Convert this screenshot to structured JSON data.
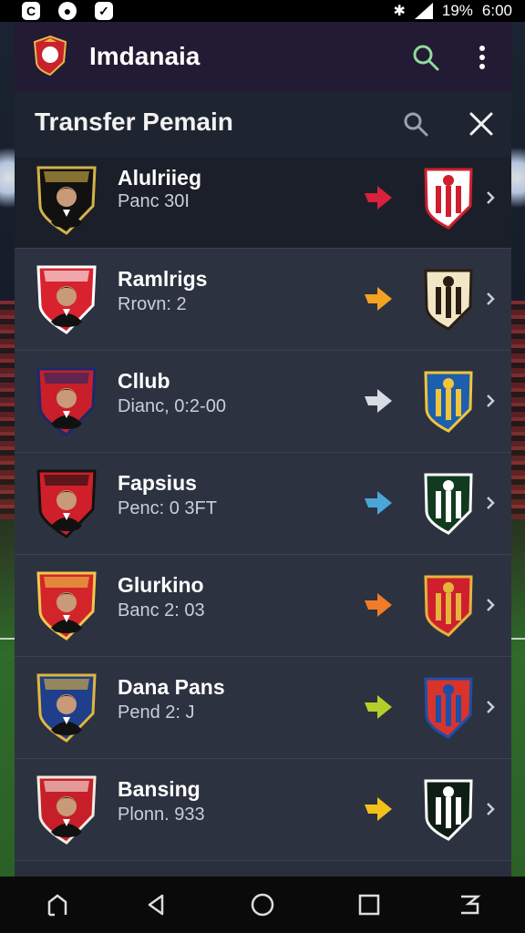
{
  "status_bar": {
    "left_icons": [
      "c-app-icon",
      "circle-app-icon",
      "check-app-icon"
    ],
    "battery": "19%",
    "time": "6:00"
  },
  "app": {
    "title": "Imdanaia",
    "icons": [
      "search-icon",
      "more-vert-icon"
    ]
  },
  "screen": {
    "title": "Transfer Pemain",
    "icons": [
      "search-icon",
      "close-icon"
    ]
  },
  "players": [
    {
      "name": "Alulriieg",
      "detail": "Panc 30I",
      "arrow_color": "#d8213a",
      "player_badge_colors": [
        "#111111",
        "#d4b24a"
      ],
      "club_badge_colors": [
        "#ffffff",
        "#cf1f2e"
      ]
    },
    {
      "name": "Ramlrigs",
      "detail": "Rrovn: 2",
      "arrow_color": "#f2a321",
      "player_badge_colors": [
        "#d8232f",
        "#ffffff"
      ],
      "club_badge_colors": [
        "#f1e7c7",
        "#2a1e12"
      ]
    },
    {
      "name": "Cllub",
      "detail": "Dianc, 0:2-00",
      "arrow_color": "#d7dbe3",
      "player_badge_colors": [
        "#c81f2a",
        "#1a2a6b"
      ],
      "club_badge_colors": [
        "#1c5fae",
        "#f1c43c"
      ]
    },
    {
      "name": "Fapsius",
      "detail": "Penc: 0 3FT",
      "arrow_color": "#4aa6d8",
      "player_badge_colors": [
        "#cf1f2a",
        "#111111"
      ],
      "club_badge_colors": [
        "#123a1f",
        "#ffffff"
      ]
    },
    {
      "name": "Glurkino",
      "detail": "Banc 2: 03",
      "arrow_color": "#f07c28",
      "player_badge_colors": [
        "#d2252a",
        "#f2c84b"
      ],
      "club_badge_colors": [
        "#cf1f2e",
        "#e4b43d"
      ]
    },
    {
      "name": "Dana Pans",
      "detail": "Pend 2: J",
      "arrow_color": "#b4cf2a",
      "player_badge_colors": [
        "#1f3f8a",
        "#e2b540"
      ],
      "club_badge_colors": [
        "#d9342c",
        "#1c4fa8"
      ]
    },
    {
      "name": "Bansing",
      "detail": "Plonn. 933",
      "arrow_color": "#f3c21a",
      "player_badge_colors": [
        "#c71f2a",
        "#f1ece1"
      ],
      "club_badge_colors": [
        "#0f1e14",
        "#ffffff"
      ]
    }
  ],
  "nav": {
    "icons": [
      "home-icon",
      "back-icon",
      "circle-home-icon",
      "recents-icon",
      "menu-icon"
    ]
  }
}
